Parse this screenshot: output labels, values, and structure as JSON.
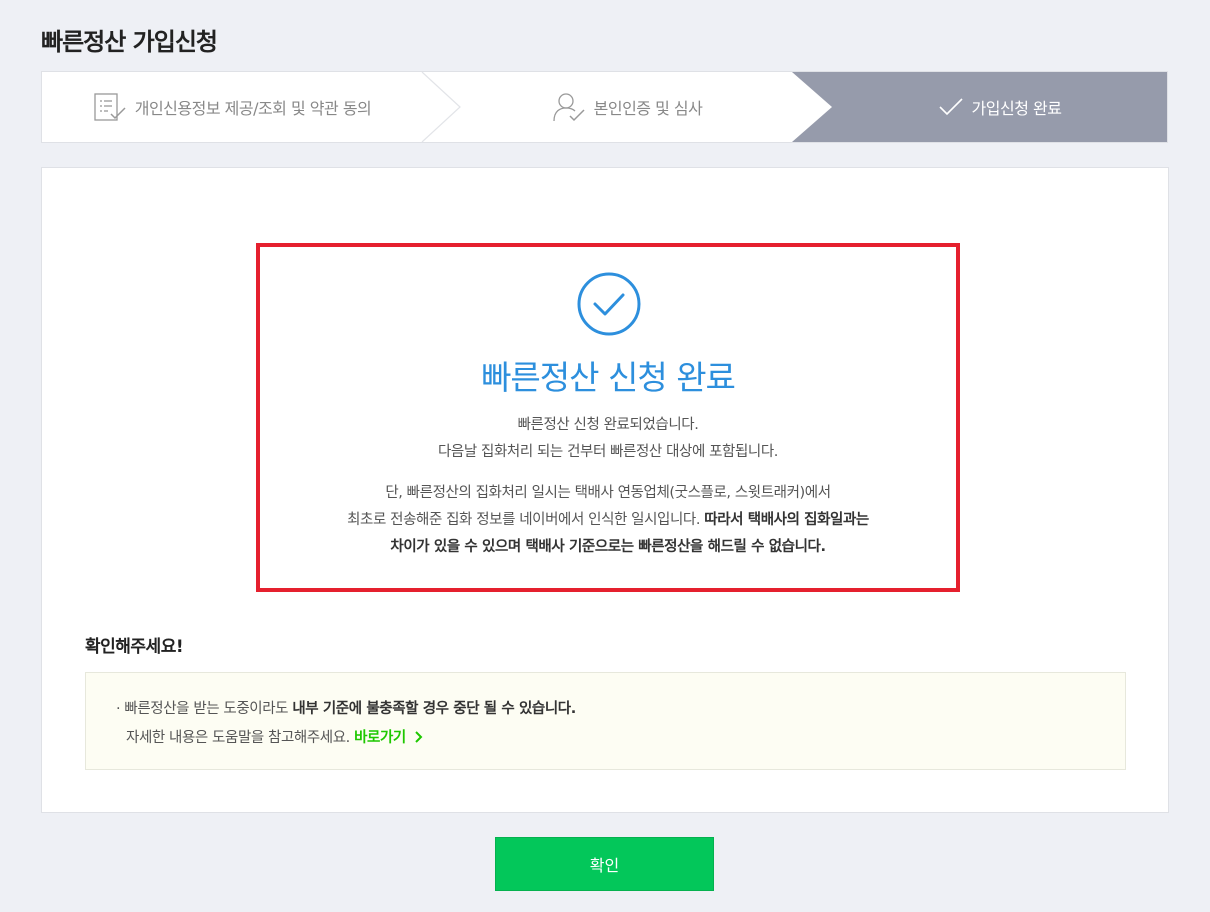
{
  "page": {
    "title": "빠른정산 가입신청"
  },
  "steps": [
    {
      "label": "개인신용정보 제공/조회 및 약관 동의",
      "icon": "document-checklist-icon",
      "active": false
    },
    {
      "label": "본인인증 및 심사",
      "icon": "person-check-icon",
      "active": false
    },
    {
      "label": "가입신청 완료",
      "icon": "checkmark-icon",
      "active": true
    }
  ],
  "result": {
    "icon": "check-circle-icon",
    "title": "빠른정산 신청 완료",
    "line1": "빠른정산 신청 완료되었습니다.",
    "line2": "다음날 집화처리 되는 건부터 빠른정산 대상에 포함됩니다.",
    "line3": "단, 빠른정산의 집화처리 일시는 택배사 연동업체(굿스플로, 스윗트래커)에서",
    "line4_normal": "최초로 전송해준 집화 정보를 네이버에서 인식한 일시입니다.",
    "line4_bold": "따라서 택배사의 집화일과는",
    "line5_bold": "차이가 있을 수 있으며 택배사 기준으로는 빠른정산을 해드릴 수 없습니다."
  },
  "notice": {
    "heading": "확인해주세요!",
    "line1_prefix": "· 빠른정산을 받는 도중이라도",
    "line1_bold": "내부 기준에 불충족할 경우 중단 될 수 있습니다.",
    "line2": "자세한 내용은 도움말을 참고해주세요.",
    "link_label": "바로가기",
    "link_color": "#1ec800"
  },
  "colors": {
    "accent": "#2d8fdd",
    "highlight_border": "#e5202e",
    "button": "#03c75a",
    "active_step": "#969bab"
  },
  "confirm_button": {
    "label": "확인"
  }
}
